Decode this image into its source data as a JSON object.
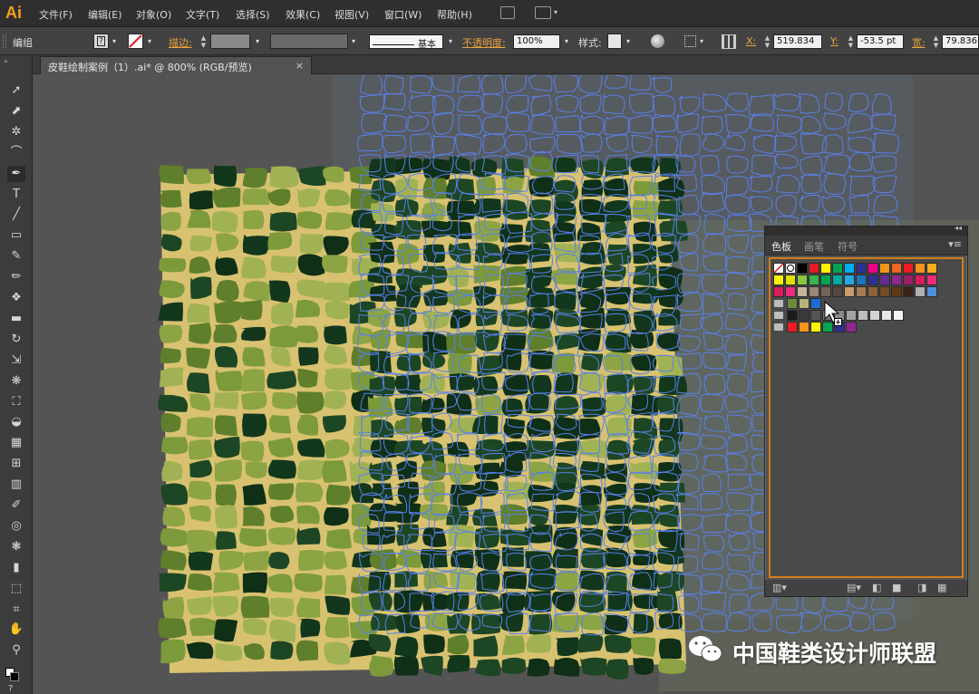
{
  "app": {
    "logo": "Ai"
  },
  "menubar": {
    "items": [
      "文件(F)",
      "编辑(E)",
      "对象(O)",
      "文字(T)",
      "选择(S)",
      "效果(C)",
      "视图(V)",
      "窗口(W)",
      "帮助(H)"
    ]
  },
  "controlbar": {
    "selection_label": "编组",
    "stroke_label": "描边:",
    "stroke_style": "基本",
    "opacity_label": "不透明度:",
    "opacity_value": "100%",
    "style_label": "样式:",
    "x_label": "X:",
    "x_value": "519.834",
    "y_label": "Y:",
    "y_value": "-53.5 pt",
    "w_label": "宽:",
    "w_value": "79.836"
  },
  "document": {
    "tab_title": "皮鞋绘制案例（1）.ai* @ 800% (RGB/预览)",
    "close_glyph": "×"
  },
  "tools": [
    "selection-tool",
    "direct-selection-tool",
    "magic-wand-tool",
    "lasso-tool",
    "pen-tool",
    "type-tool",
    "line-tool",
    "rectangle-tool",
    "paintbrush-tool",
    "pencil-tool",
    "blob-brush-tool",
    "eraser-tool",
    "rotate-tool",
    "scale-tool",
    "warp-tool",
    "free-transform-tool",
    "shape-builder-tool",
    "perspective-grid-tool",
    "mesh-tool",
    "gradient-tool",
    "eyedropper-tool",
    "blend-tool",
    "symbol-sprayer-tool",
    "column-graph-tool",
    "artboard-tool",
    "slice-tool",
    "hand-tool",
    "zoom-tool"
  ],
  "swatches_panel": {
    "tabs": [
      "色板",
      "画笔",
      "符号"
    ],
    "active_tab": "色板",
    "rows": [
      [
        "#ffffff",
        "#ffffff",
        "#000000",
        "#e31b23",
        "#fff200",
        "#00a651",
        "#00aeef",
        "#2e3192",
        "#ec008c",
        "#f7941d",
        "#f26522",
        "#ed1c24",
        "#f7941d",
        "#f7ac1d"
      ],
      [
        "#fff200",
        "#e0e000",
        "#8dc63f",
        "#39b54a",
        "#00a651",
        "#00a99d",
        "#27aae1",
        "#1b75bc",
        "#2e3192",
        "#662d91",
        "#92278f",
        "#9e1f63",
        "#da1c5c",
        "#ee2a7b"
      ],
      [
        "#da1c5c",
        "#ee2a7b",
        "#c2b59b",
        "#998675",
        "#736357",
        "#534741",
        "#c69c6d",
        "#a67c52",
        "#8c6239",
        "#754c24",
        "#603913",
        "#3c2415",
        "#b0b0b0",
        "#4e90e0"
      ],
      [
        "#6e8a3c",
        "#b9b277",
        "#1d6fd6"
      ],
      [
        "#1c1c1c",
        "#3a3a3a",
        "#555555",
        "#707070",
        "#8a8a8a",
        "#a3a3a3",
        "#bcbcbc",
        "#d4d4d4",
        "#e6e6e6",
        "#f5f5f5"
      ],
      [
        "#ed1c24",
        "#f7941d",
        "#fff200",
        "#00a651",
        "#2e3192",
        "#92278f"
      ]
    ]
  },
  "watermark": {
    "text": "中国鞋类设计师联盟"
  }
}
